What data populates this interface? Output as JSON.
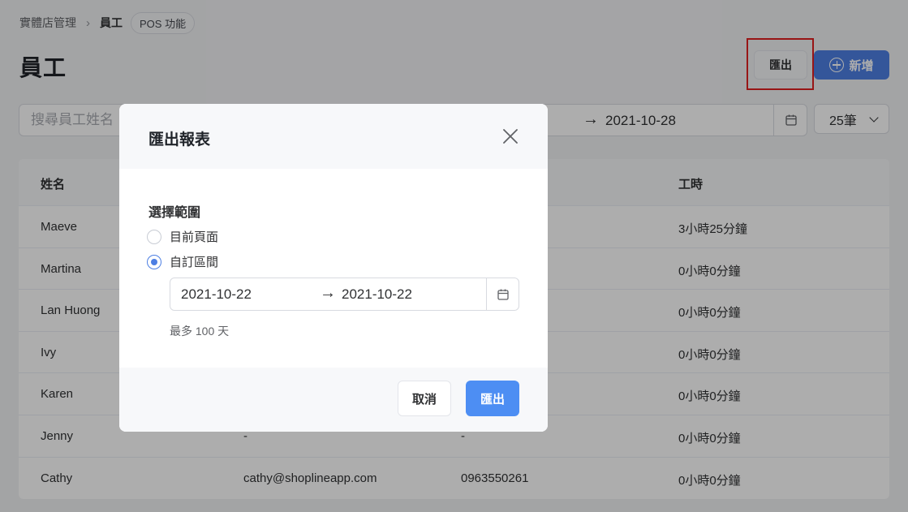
{
  "breadcrumb": {
    "root": "實體店管理",
    "current": "員工",
    "tag": "POS 功能"
  },
  "page": {
    "title": "員工"
  },
  "header_actions": {
    "export_label": "匯出",
    "add_label": "新增"
  },
  "filters": {
    "search_placeholder": "搜尋員工姓名",
    "range_arrow": "→",
    "range_end": "2021-10-28",
    "per_page": "25筆"
  },
  "table": {
    "columns": [
      "姓名",
      "",
      "",
      "工時"
    ],
    "rows": [
      {
        "name": "Maeve",
        "email": "",
        "phone": "",
        "hours": "3小時25分鐘"
      },
      {
        "name": "Martina",
        "email": "",
        "phone": "",
        "hours": "0小時0分鐘"
      },
      {
        "name": "Lan Huong",
        "email": "",
        "phone": "",
        "hours": "0小時0分鐘"
      },
      {
        "name": "Ivy",
        "email": "",
        "phone": "",
        "hours": "0小時0分鐘"
      },
      {
        "name": "Karen",
        "email": "",
        "phone": "",
        "hours": "0小時0分鐘"
      },
      {
        "name": "Jenny",
        "email": "-",
        "phone": "-",
        "hours": "0小時0分鐘"
      },
      {
        "name": "Cathy",
        "email": "cathy@shoplineapp.com",
        "phone": "0963550261",
        "hours": "0小時0分鐘"
      }
    ]
  },
  "modal": {
    "title": "匯出報表",
    "section_label": "選擇範圍",
    "options": [
      {
        "label": "目前頁面",
        "checked": false
      },
      {
        "label": "自訂區間",
        "checked": true
      }
    ],
    "range_start": "2021-10-22",
    "range_arrow": "→",
    "range_end": "2021-10-22",
    "hint": "最多 100 天",
    "cancel_label": "取消",
    "confirm_label": "匯出"
  },
  "colors": {
    "primary": "#4d7fe3",
    "confirm": "#4d8ef3",
    "highlight": "#e02020"
  }
}
